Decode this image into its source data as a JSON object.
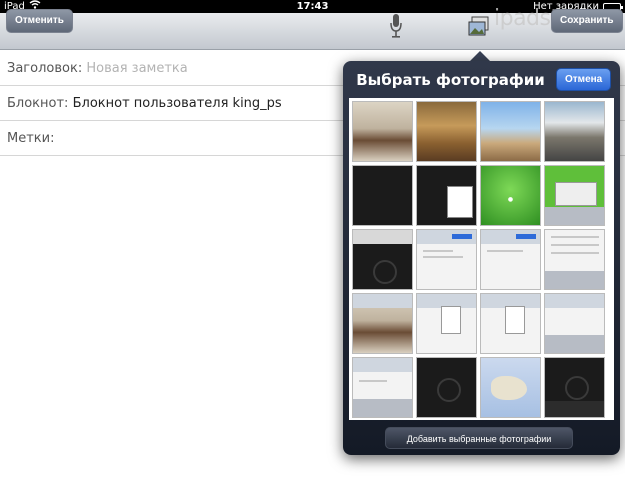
{
  "status_bar": {
    "device": "iPad",
    "time": "17:43",
    "charging": "Нет зарядки"
  },
  "toolbar": {
    "cancel_label": "Отменить",
    "save_label": "Сохранить",
    "watermark": "ipadstory.ru"
  },
  "form": {
    "title_label": "Заголовок:",
    "title_placeholder": "Новая заметка",
    "notebook_label": "Блокнот:",
    "notebook_value": "Блокнот пользователя king_ps",
    "tags_label": "Метки:"
  },
  "photo_picker": {
    "title": "Выбрать фотографии",
    "cancel_label": "Отмена",
    "add_button_label": "Добавить выбранные фотографии",
    "thumbnails": [
      "photo1",
      "photo2",
      "photo3",
      "photo4",
      "dark",
      "dark-form",
      "green",
      "screen-green",
      "dark",
      "light",
      "light",
      "light-list",
      "light-photo",
      "light-menu",
      "light-menu",
      "light-keyboard",
      "light-keyboard",
      "dark",
      "map",
      "dark"
    ]
  },
  "colors": {
    "accent_blue": "#2a66d6",
    "popover_dark": "#1b2230"
  }
}
